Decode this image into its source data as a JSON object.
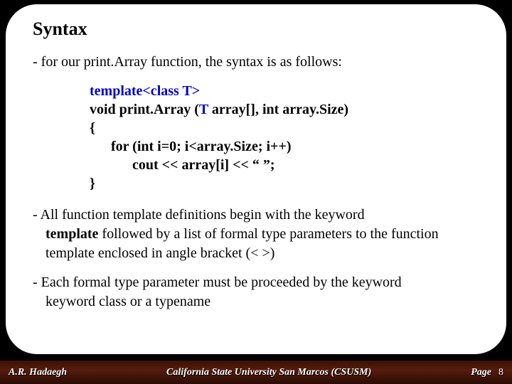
{
  "title": "Syntax",
  "intro": "- for our print.Array function, the syntax is as follows:",
  "code": {
    "l1a": "template<class ",
    "l1b": "T",
    "l1c": ">",
    "l2a": "void print.Array (",
    "l2b": "T",
    "l2c": " array[], int array.Size)",
    "l3": "{",
    "l4": "      for (int i=0; i<array.Size; i++)",
    "l5": "            cout << array[i] << “ ”;",
    "l6": "}"
  },
  "para1_a": "- All function template definitions begin with the keyword",
  "para1_b": "template",
  "para1_c": " followed by a list of formal type parameters to the function template enclosed in angle bracket (<  >)",
  "para2_a": "- Each formal type parameter must be proceeded by the keyword ",
  "para2_b": "class",
  "para2_c": " or a ",
  "para2_d": "typename",
  "footer": {
    "author": "A.R. Hadaegh",
    "university": "California State University San Marcos (CSUSM)",
    "page_label": "Page",
    "page_number": "8"
  }
}
